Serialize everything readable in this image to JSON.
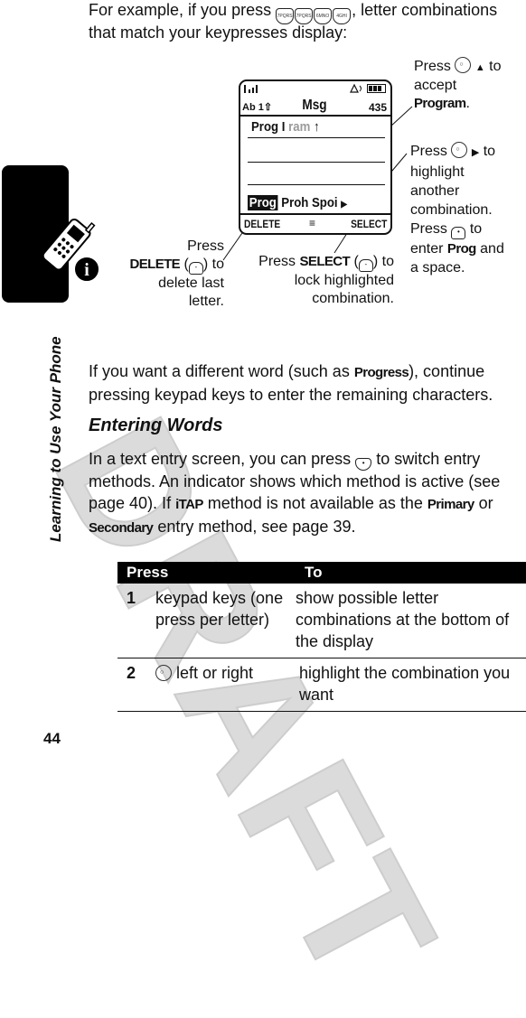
{
  "intro": {
    "line1_prefix": "For example, if you press",
    "keys": [
      "7PQRS",
      "7PQRS",
      "6MNO",
      "4GHI"
    ],
    "line1_suffix": ", letter combinations",
    "line2": "that match your keypresses display:"
  },
  "phone_screen": {
    "status_icons": [
      "signal-strength-icon",
      "ringer-icon",
      "battery-icon"
    ],
    "entry_mode": "Ab 1",
    "title": "Msg",
    "char_count": "435",
    "typed_bold": "Prog I",
    "typed_grey": "ram",
    "cursor": "↑",
    "combo_highlighted": "Prog",
    "combo_others": "Proh Spoi",
    "more_arrow": "▶",
    "softkey_left": "DELETE",
    "softkey_menu": "≡",
    "softkey_right": "SELECT"
  },
  "callouts": {
    "accept": {
      "press": "Press",
      "arrow": "▲",
      "to": "to",
      "line2": "accept",
      "bold": "Program",
      "end": "."
    },
    "highlight": {
      "press": "Press",
      "arrow": "▶",
      "to": "to",
      "lines": [
        "highlight",
        "another",
        "combination."
      ],
      "press2": "Press",
      "to2": "to",
      "enter": "enter",
      "bold": "Prog",
      "and": "and",
      "last": "a space."
    },
    "delete": {
      "line1": "Press",
      "bold": "DELETE",
      "rest": "to",
      "line3": "delete last",
      "line4": "letter."
    },
    "select": {
      "press": "Press",
      "bold": "SELECT",
      "to": "to",
      "line2": "lock highlighted",
      "line3": "combination."
    }
  },
  "paragraph1": {
    "text1": "If you want a different word (such as ",
    "bold": "Progress",
    "text2": "), continue",
    "line2": "pressing keypad keys to enter the remaining characters."
  },
  "section_heading": "Entering Words",
  "paragraph2": {
    "t1": "In a text entry screen, you can press",
    "t2": "to switch entry",
    "line2": "methods. An indicator shows which method is active (see",
    "line3a": "page 40). If ",
    "itap": "iTAP",
    "line3b": " method is not available as the ",
    "primary": "Primary",
    "line3c": " or",
    "secondary": "Secondary",
    "line4": " entry method, see page 39."
  },
  "table": {
    "headers": [
      "Press",
      "To"
    ],
    "rows": [
      {
        "num": "1",
        "press": "keypad keys (one press per letter)",
        "to": "show possible letter combinations at the bottom of the display"
      },
      {
        "num": "2",
        "press": "left or right",
        "to": "highlight the combination you want"
      }
    ]
  },
  "sidebar": {
    "title": "Learning to Use Your Phone"
  },
  "watermark": "DRAFT",
  "page_number": "44"
}
